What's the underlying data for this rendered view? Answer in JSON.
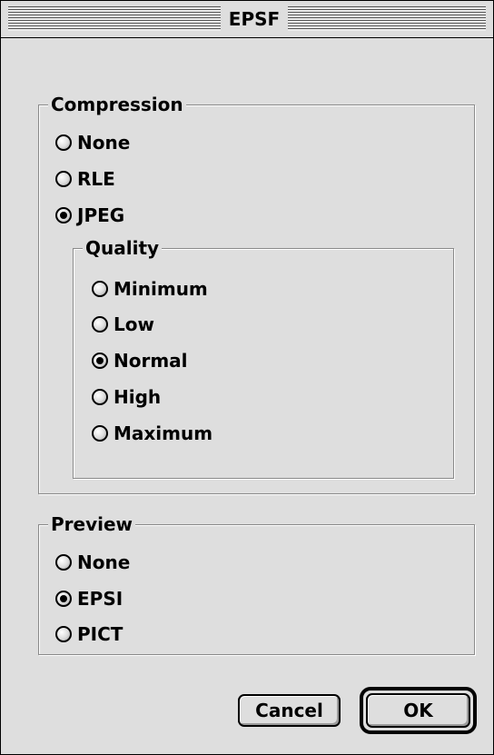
{
  "window": {
    "title": "EPSF"
  },
  "compression": {
    "legend": "Compression",
    "options": [
      "None",
      "RLE",
      "JPEG"
    ],
    "selected": "JPEG",
    "quality": {
      "legend": "Quality",
      "options": [
        "Minimum",
        "Low",
        "Normal",
        "High",
        "Maximum"
      ],
      "selected": "Normal"
    }
  },
  "preview": {
    "legend": "Preview",
    "options": [
      "None",
      "EPSI",
      "PICT"
    ],
    "selected": "EPSI"
  },
  "buttons": {
    "cancel_label": "Cancel",
    "ok_label": "OK"
  }
}
